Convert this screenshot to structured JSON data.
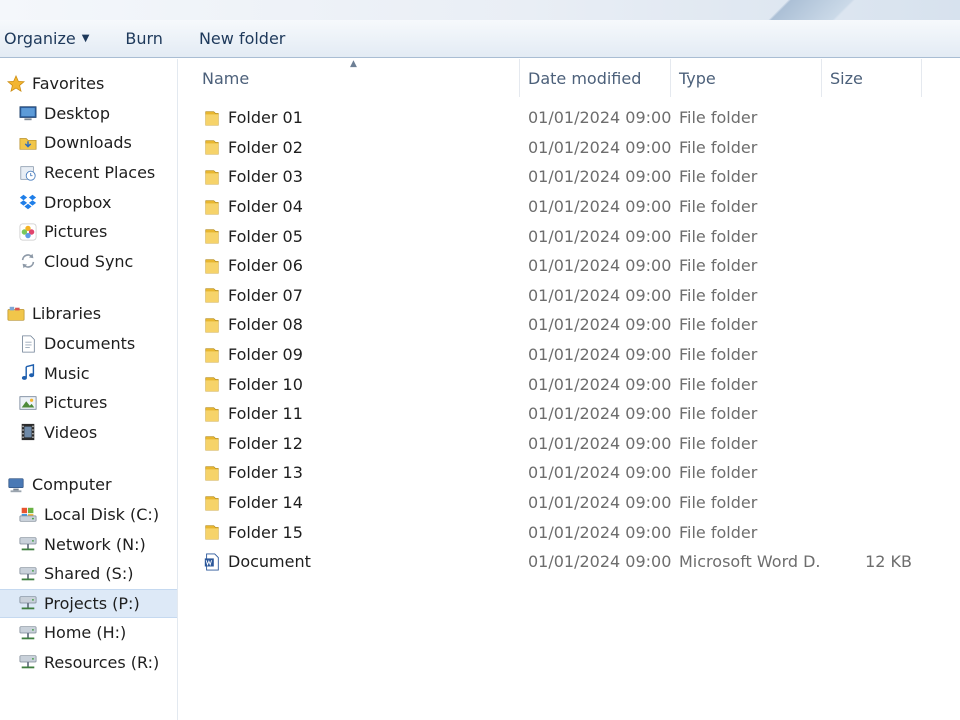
{
  "toolbar": {
    "organize_label": "Organize",
    "burn_label": "Burn",
    "new_folder_label": "New folder"
  },
  "nav": {
    "favorites": {
      "label": "Favorites",
      "items": [
        {
          "label": "Desktop",
          "icon": "desktop-icon"
        },
        {
          "label": "Downloads",
          "icon": "downloads-folder-icon"
        },
        {
          "label": "Recent Places",
          "icon": "recent-places-icon"
        },
        {
          "label": "Dropbox",
          "icon": "dropbox-icon"
        },
        {
          "label": "Pictures",
          "icon": "photos-icon"
        },
        {
          "label": "Cloud Sync",
          "icon": "sync-icon"
        }
      ]
    },
    "libraries": {
      "label": "Libraries",
      "items": [
        {
          "label": "Documents",
          "icon": "documents-icon"
        },
        {
          "label": "Music",
          "icon": "music-icon"
        },
        {
          "label": "Pictures",
          "icon": "pictures-icon"
        },
        {
          "label": "Videos",
          "icon": "videos-icon"
        }
      ]
    },
    "computer": {
      "label": "Computer",
      "items": [
        {
          "label": "Local Disk (C:)",
          "icon": "drive-icon"
        },
        {
          "label": "Network (N:)",
          "icon": "network-drive-icon"
        },
        {
          "label": "Shared (S:)",
          "icon": "network-drive-icon"
        },
        {
          "label": "Projects (P:)",
          "icon": "network-drive-icon",
          "selected": true
        },
        {
          "label": "Home (H:)",
          "icon": "network-drive-icon"
        },
        {
          "label": "Resources (R:)",
          "icon": "network-drive-icon"
        }
      ]
    }
  },
  "columns": {
    "name": "Name",
    "date": "Date modified",
    "type": "Type",
    "size": "Size"
  },
  "rows": [
    {
      "name": "Folder 01",
      "date": "01/01/2024 09:00",
      "type": "File folder",
      "size": "",
      "kind": "folder"
    },
    {
      "name": "Folder 02",
      "date": "01/01/2024 09:00",
      "type": "File folder",
      "size": "",
      "kind": "folder"
    },
    {
      "name": "Folder 03",
      "date": "01/01/2024 09:00",
      "type": "File folder",
      "size": "",
      "kind": "folder"
    },
    {
      "name": "Folder 04",
      "date": "01/01/2024 09:00",
      "type": "File folder",
      "size": "",
      "kind": "folder"
    },
    {
      "name": "Folder 05",
      "date": "01/01/2024 09:00",
      "type": "File folder",
      "size": "",
      "kind": "folder"
    },
    {
      "name": "Folder 06",
      "date": "01/01/2024 09:00",
      "type": "File folder",
      "size": "",
      "kind": "folder"
    },
    {
      "name": "Folder 07",
      "date": "01/01/2024 09:00",
      "type": "File folder",
      "size": "",
      "kind": "folder"
    },
    {
      "name": "Folder 08",
      "date": "01/01/2024 09:00",
      "type": "File folder",
      "size": "",
      "kind": "folder"
    },
    {
      "name": "Folder 09",
      "date": "01/01/2024 09:00",
      "type": "File folder",
      "size": "",
      "kind": "folder"
    },
    {
      "name": "Folder 10",
      "date": "01/01/2024 09:00",
      "type": "File folder",
      "size": "",
      "kind": "folder"
    },
    {
      "name": "Folder 11",
      "date": "01/01/2024 09:00",
      "type": "File folder",
      "size": "",
      "kind": "folder"
    },
    {
      "name": "Folder 12",
      "date": "01/01/2024 09:00",
      "type": "File folder",
      "size": "",
      "kind": "folder"
    },
    {
      "name": "Folder 13",
      "date": "01/01/2024 09:00",
      "type": "File folder",
      "size": "",
      "kind": "folder"
    },
    {
      "name": "Folder 14",
      "date": "01/01/2024 09:00",
      "type": "File folder",
      "size": "",
      "kind": "folder"
    },
    {
      "name": "Folder 15",
      "date": "01/01/2024 09:00",
      "type": "File folder",
      "size": "",
      "kind": "folder"
    },
    {
      "name": "Document",
      "date": "01/01/2024 09:00",
      "type": "Microsoft Word D...",
      "size": "12 KB",
      "kind": "word"
    }
  ],
  "colors": {
    "toolbar_text": "#1e395b",
    "folder_yellow": "#f1c64a",
    "selection": "#dde9f7"
  }
}
